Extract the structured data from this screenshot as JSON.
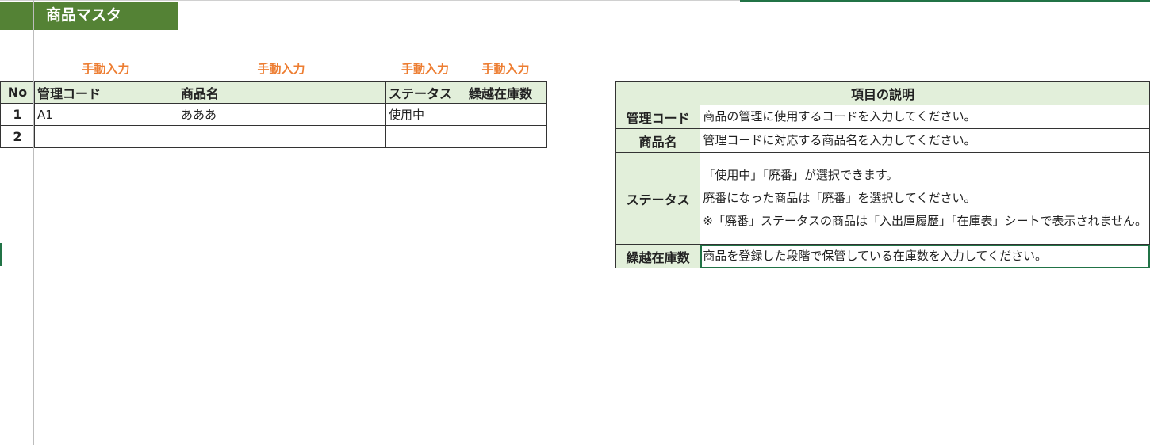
{
  "sheet_title": "商品マスタ",
  "manual_label": "手動入力",
  "master": {
    "headers": [
      "No",
      "管理コード",
      "商品名",
      "ステータス",
      "繰越在庫数"
    ],
    "rows": [
      {
        "no": "1",
        "code": "A1",
        "name": "あああ",
        "status": "使用中",
        "stock": ""
      },
      {
        "no": "2",
        "code": "",
        "name": "",
        "status": "",
        "stock": ""
      }
    ]
  },
  "description": {
    "title": "項目の説明",
    "items": [
      {
        "key": "管理コード",
        "lines": [
          "商品の管理に使用するコードを入力してください。"
        ]
      },
      {
        "key": "商品名",
        "lines": [
          "管理コードに対応する商品名を入力してください。"
        ]
      },
      {
        "key": "ステータス",
        "lines": [
          "「使用中」「廃番」が選択できます。",
          "廃番になった商品は「廃番」を選択してください。",
          "※「廃番」ステータスの商品は「入出庫履歴」「在庫表」シートで表示されません。"
        ]
      },
      {
        "key": "繰越在庫数",
        "lines": [
          "商品を登録した段階で保管している在庫数を入力してください。"
        ]
      }
    ]
  },
  "colors": {
    "title_bg": "#548235",
    "header_bg": "#e2efda",
    "manual_label": "#ed7d31",
    "selection": "#217346"
  }
}
